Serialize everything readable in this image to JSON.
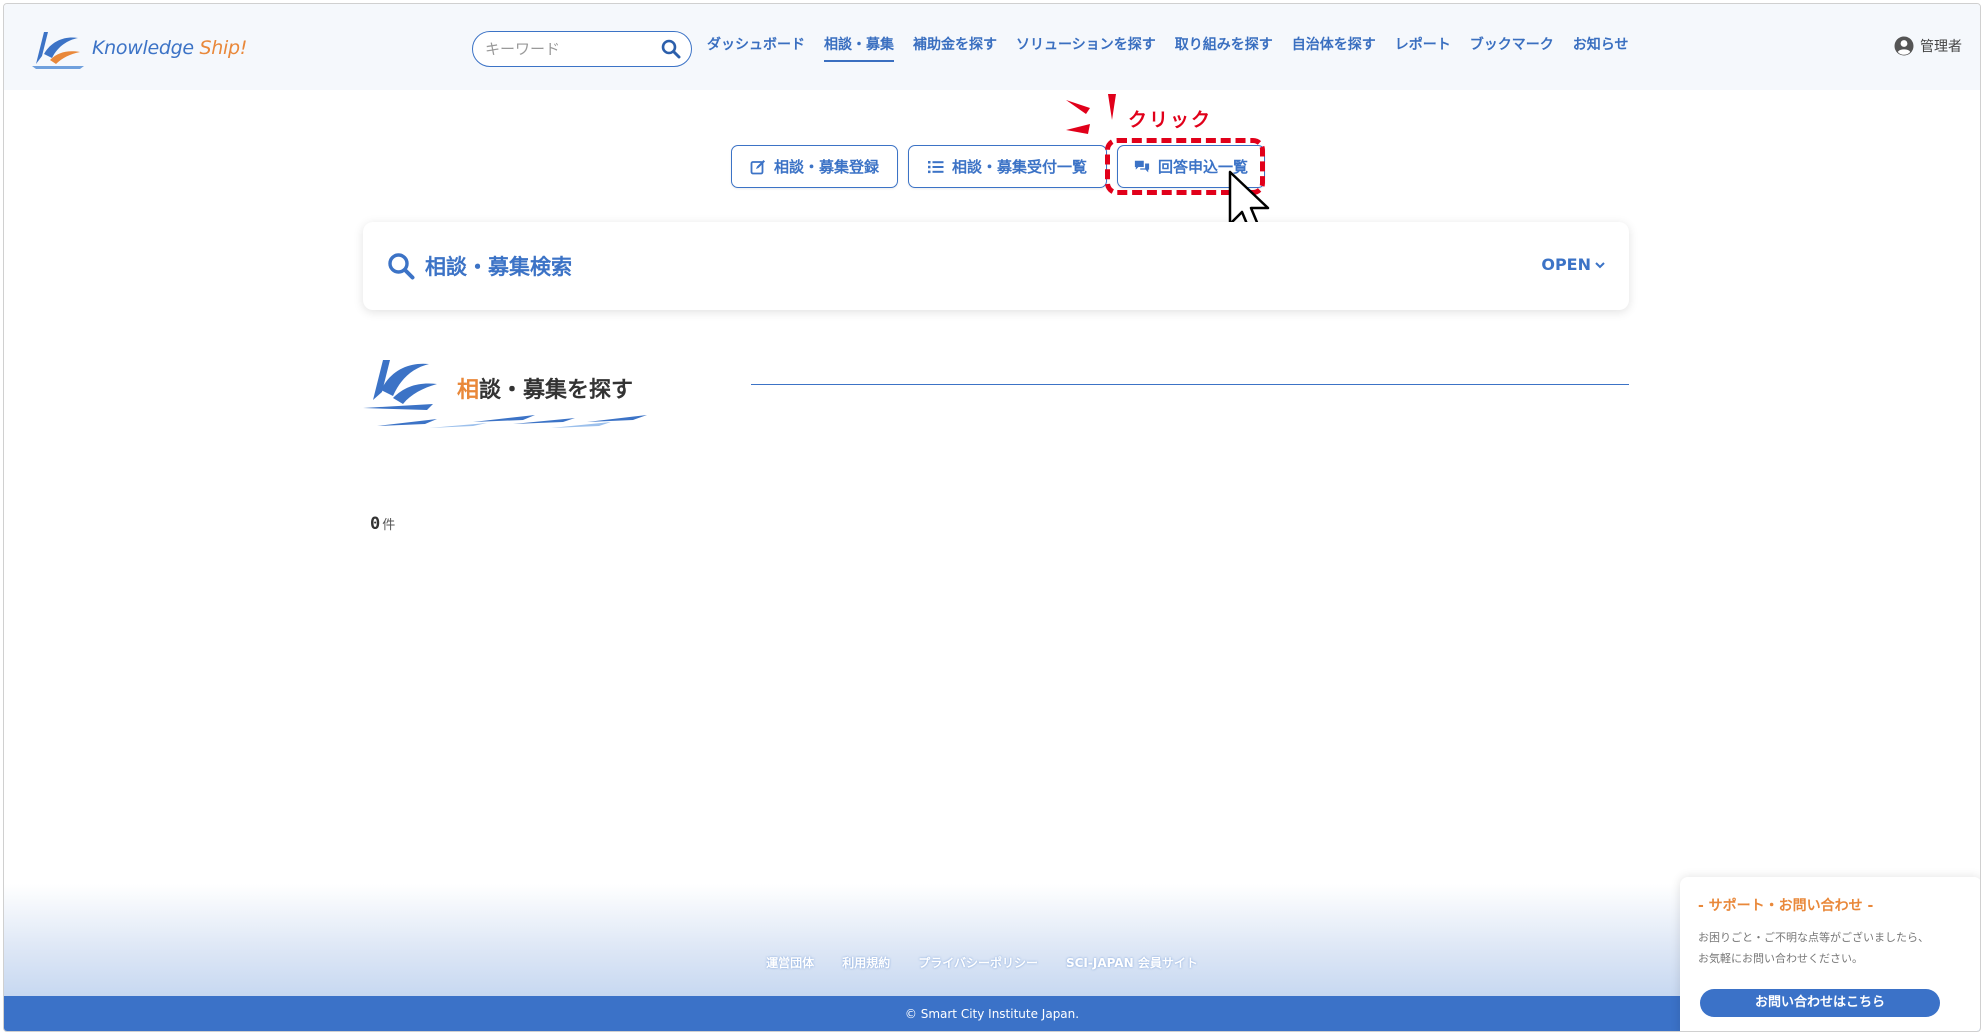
{
  "header": {
    "logo_prefix": "Knowledge ",
    "logo_accent": "Ship!",
    "search_placeholder": "キーワード",
    "nav": [
      {
        "label": "ダッシュボード"
      },
      {
        "label": "相談・募集"
      },
      {
        "label": "補助金を探す"
      },
      {
        "label": "ソリューションを探す"
      },
      {
        "label": "取り組みを探す"
      },
      {
        "label": "自治体を探す"
      },
      {
        "label": "レポート"
      },
      {
        "label": "ブックマーク"
      },
      {
        "label": "お知らせ"
      }
    ],
    "active_nav_index": 1,
    "user_label": "管理者"
  },
  "actions": {
    "register": "相談・募集登録",
    "received_list": "相談・募集受付一覧",
    "answers_list": "回答申込一覧"
  },
  "annotation": {
    "click_label": "クリック"
  },
  "search_panel": {
    "title": "相談・募集検索",
    "toggle": "OPEN"
  },
  "section": {
    "title_first": "相",
    "title_rest": "談・募集を探す"
  },
  "results": {
    "count": "0",
    "unit": "件"
  },
  "footer": {
    "links": [
      "運営団体",
      "利用規約",
      "プライバシーポリシー",
      "SCI-JAPAN 会員サイト"
    ],
    "copyright": "© Smart City Institute Japan."
  },
  "support": {
    "title": "- サポート・お問い合わせ -",
    "text_line1": "お困りごと・ご不明な点等がございましたら、",
    "text_line2": "お気軽にお問い合わせください。",
    "button": "お問い合わせはこちら"
  },
  "colors": {
    "brand_blue": "#3c73c6",
    "accent_orange": "#e9883a",
    "annotation_red": "#e1001a"
  }
}
